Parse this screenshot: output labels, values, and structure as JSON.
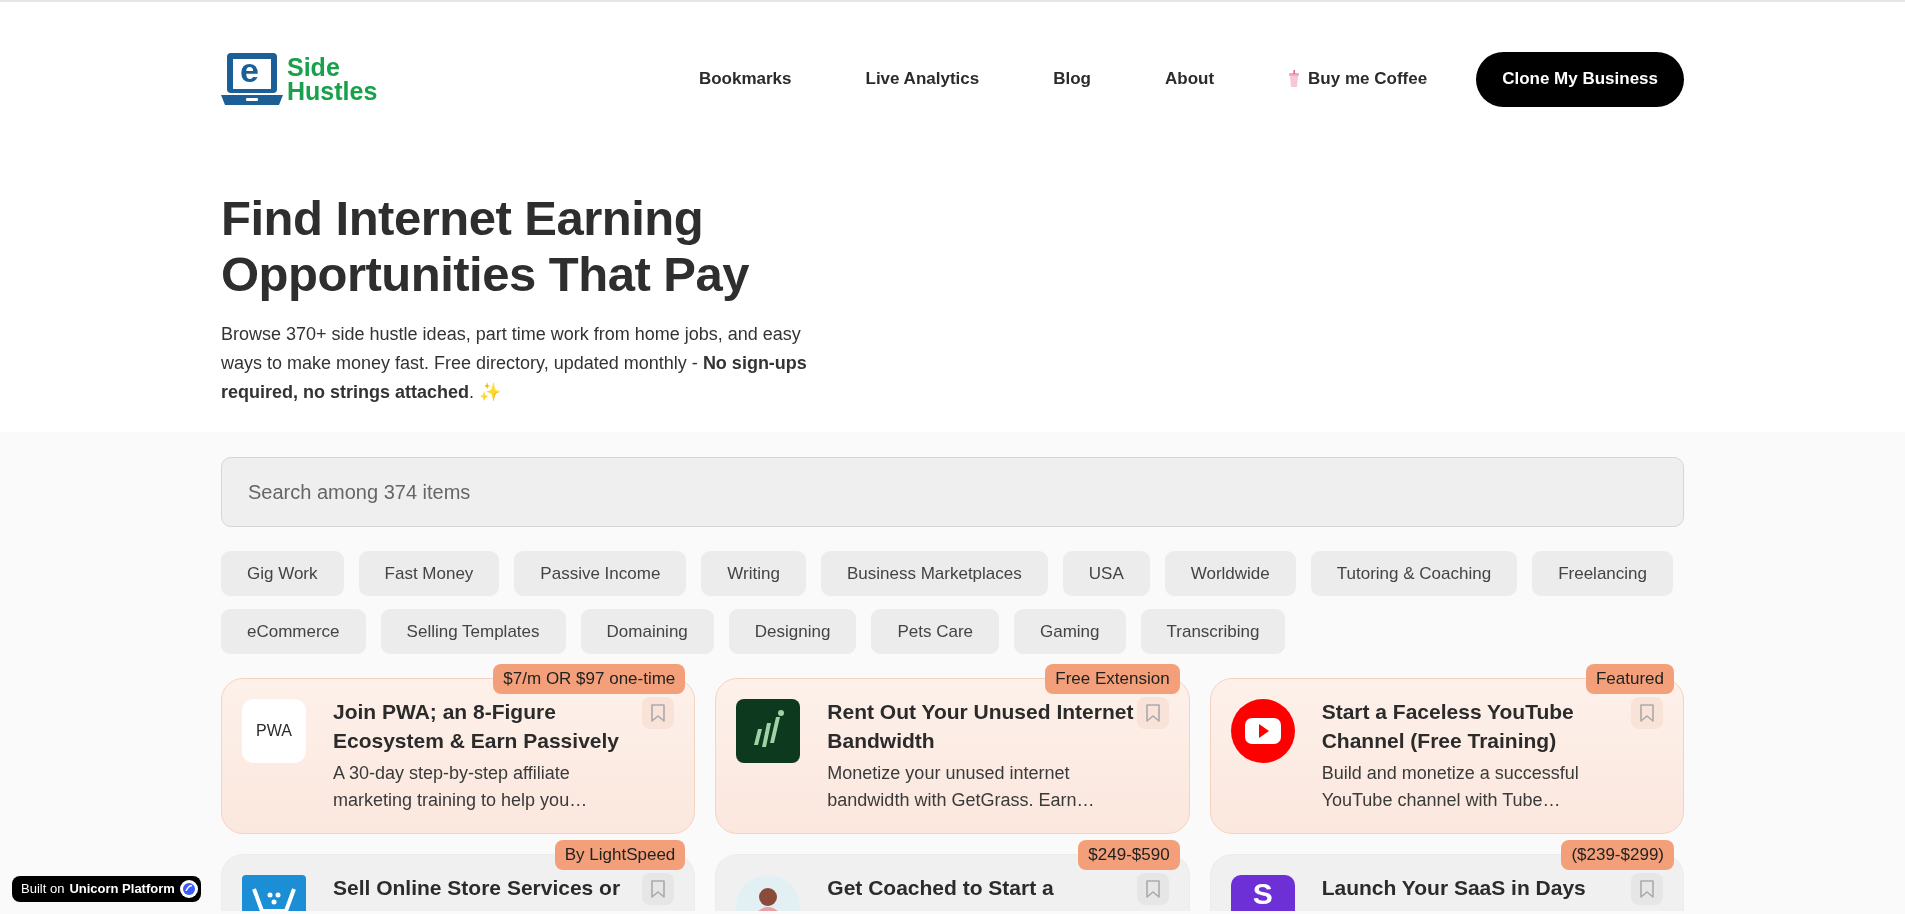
{
  "logo": {
    "mark": "e",
    "line_1": "Side",
    "line_2": "Hustles"
  },
  "nav": {
    "links": [
      {
        "label": "Bookmarks",
        "kind": "link"
      },
      {
        "label": "Live Analytics",
        "kind": "link"
      },
      {
        "label": "Blog",
        "kind": "link"
      },
      {
        "label": "About",
        "kind": "link"
      },
      {
        "label": "Buy me Coffee",
        "kind": "coffee"
      }
    ],
    "cta": "Clone My Business"
  },
  "hero": {
    "title_line_1": "Find Internet Earning",
    "title_line_2": "Opportunities That Pay",
    "description": "Browse 370+ side hustle ideas, part time work from home jobs, and easy ways to make money fast. Free directory, updated monthly - **No sign-ups required, no strings attached**. ✨"
  },
  "search": {
    "placeholder": "Search among 374 items"
  },
  "tags": [
    "Gig Work",
    "Fast Money",
    "Passive Income",
    "Writing",
    "Business Marketplaces",
    "USA",
    "Worldwide",
    "Tutoring & Coaching",
    "Freelancing",
    "eCommerce",
    "Selling Templates",
    "Domaining",
    "Designing",
    "Pets Care",
    "Gaming",
    "Transcribing"
  ],
  "cards": [
    {
      "badge": "$7/m OR $97 one-time",
      "title": "Join PWA; an 8-Figure Ecosystem & Earn Passively",
      "description": "A 30-day step-by-step affiliate marketing training to help you…",
      "logo": {
        "kind": "pwa",
        "text": "PWA"
      },
      "highlighted": true
    },
    {
      "badge": "Free Extension",
      "title": "Rent Out Your Unused Internet Bandwidth",
      "description": "Monetize your unused internet bandwidth with GetGrass. Earn…",
      "logo": {
        "kind": "grass"
      },
      "highlighted": true
    },
    {
      "badge": "Featured",
      "title": "Start a Faceless YouTube Channel (Free Training)",
      "description": "Build and monetize a successful YouTube channel with Tube…",
      "logo": {
        "kind": "youtube"
      },
      "highlighted": true
    },
    {
      "badge": "By LightSpeed",
      "title": "Sell Online Store Services or",
      "logo": {
        "kind": "cart"
      },
      "highlighted": false
    },
    {
      "badge": "$249-$590",
      "title": "Get Coached to Start a",
      "logo": {
        "kind": "person"
      },
      "highlighted": false
    },
    {
      "badge": "($239-$299)",
      "title": "Launch Your SaaS in Days",
      "logo": {
        "kind": "saas",
        "text": "S"
      },
      "highlighted": false
    }
  ],
  "builder_badge": {
    "prefix": "Built on",
    "name": "Unicorn Platform"
  }
}
